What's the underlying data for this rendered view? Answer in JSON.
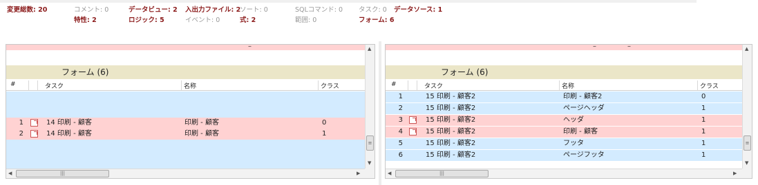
{
  "summary": {
    "row1": [
      {
        "label": "変更総数: 20",
        "style": "b"
      },
      {
        "label": "コメント: 0",
        "style": "g"
      },
      {
        "label": "データビュー: 2",
        "style": "b"
      },
      {
        "label": "入出力ファイル: 2",
        "style": "b"
      },
      {
        "label": "ソート: 0",
        "style": "g"
      },
      {
        "label": "SQLコマンド: 0",
        "style": "g"
      },
      {
        "label": "タスク: 0",
        "style": "g"
      },
      {
        "label": "データソース: 1",
        "style": "b"
      }
    ],
    "row2": [
      {
        "label": "特性: 2",
        "style": "b"
      },
      {
        "label": "ロジック: 5",
        "style": "b"
      },
      {
        "label": "イベント: 0",
        "style": "g"
      },
      {
        "label": "式: 2",
        "style": "b"
      },
      {
        "label": "範囲: 0",
        "style": "g"
      },
      {
        "label": "フォーム: 6",
        "style": "b"
      }
    ]
  },
  "left": {
    "section_title": "フォーム (6)",
    "columns": [
      "#",
      "タスク",
      "名称",
      "クラス"
    ],
    "rows": [
      {
        "num": "1",
        "task": "14 印刷 - 顧客",
        "name": "印刷 - 顧客",
        "cls": "0",
        "changed": true
      },
      {
        "num": "2",
        "task": "14 印刷 - 顧客",
        "name": "印刷 - 顧客",
        "cls": "1",
        "changed": true
      }
    ]
  },
  "right": {
    "section_title": "フォーム (6)",
    "columns": [
      "#",
      "タスク",
      "名称",
      "クラス"
    ],
    "rows": [
      {
        "num": "1",
        "task": "15 印刷 - 顧客2",
        "name": "印刷 - 顧客2",
        "cls": "0",
        "changed": false
      },
      {
        "num": "2",
        "task": "15 印刷 - 顧客2",
        "name": "ページヘッダ",
        "cls": "1",
        "changed": false
      },
      {
        "num": "3",
        "task": "15 印刷 - 顧客2",
        "name": "ヘッダ",
        "cls": "1",
        "changed": true
      },
      {
        "num": "4",
        "task": "15 印刷 - 顧客2",
        "name": "印刷 - 顧客",
        "cls": "1",
        "changed": true
      },
      {
        "num": "5",
        "task": "15 印刷 - 顧客2",
        "name": "フッタ",
        "cls": "1",
        "changed": false
      },
      {
        "num": "6",
        "task": "15 印刷 - 顧客2",
        "name": "ページフッタ",
        "cls": "1",
        "changed": false
      }
    ]
  },
  "icons": {
    "row_link": "external-link-icon",
    "scroll_up": "scroll-up-arrow-icon",
    "scroll_down": "scroll-down-arrow-icon",
    "scroll_left": "scroll-left-arrow-icon",
    "scroll_right": "scroll-right-arrow-icon"
  },
  "colors": {
    "changed_label": "#8b1a1a",
    "unchanged_label": "#9a9a9a",
    "section_bg": "#ebe6c8",
    "row_blue": "#d3ebff",
    "row_pink": "#ffd2d2"
  }
}
